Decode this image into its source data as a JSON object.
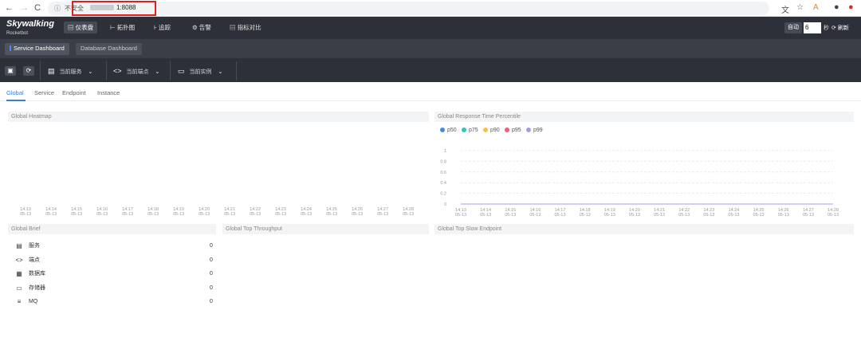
{
  "browser": {
    "security": "不安全",
    "url": "1:8088"
  },
  "app": {
    "logo": "Skywalking",
    "logo_sub": "Rocketbot",
    "nav": [
      {
        "icon": "dashboard-icon",
        "label": "仪表盘"
      },
      {
        "icon": "topology-icon",
        "label": "拓扑图"
      },
      {
        "icon": "trace-icon",
        "label": "追踪"
      },
      {
        "icon": "alarm-icon",
        "label": "告警"
      },
      {
        "icon": "metrics-compare-icon",
        "label": "指标对比"
      }
    ],
    "auto_label": "自动",
    "interval_value": "6",
    "interval_unit": "秒",
    "refresh_label": "刷新"
  },
  "dashboards": [
    "Service Dashboard",
    "Database Dashboard"
  ],
  "toolbar": {
    "selectors": [
      {
        "icon": "service-icon",
        "label": "当前服务"
      },
      {
        "icon": "endpoint-icon",
        "label": "当前端点"
      },
      {
        "icon": "instance-icon",
        "label": "当前实例"
      }
    ]
  },
  "tabs": [
    "Global",
    "Service",
    "Endpoint",
    "Instance"
  ],
  "panels": {
    "heatmap_title": "Global Heatmap",
    "percentile_title": "Global Response Time Percentile",
    "brief_title": "Global Brief",
    "throughput_title": "Global Top Throughput",
    "slow_title": "Global Top Slow Endpoint"
  },
  "heatmap_xticks": [
    [
      "14:13",
      "05-13"
    ],
    [
      "14:14",
      "05-13"
    ],
    [
      "14:15",
      "05-13"
    ],
    [
      "14:16",
      "05-13"
    ],
    [
      "14:17",
      "05-13"
    ],
    [
      "14:18",
      "05-13"
    ],
    [
      "14:19",
      "05-13"
    ],
    [
      "14:20",
      "05-13"
    ],
    [
      "14:21",
      "05-13"
    ],
    [
      "14:22",
      "05-13"
    ],
    [
      "14:23",
      "05-13"
    ],
    [
      "14:24",
      "05-13"
    ],
    [
      "14:25",
      "05-13"
    ],
    [
      "14:26",
      "05-13"
    ],
    [
      "14:27",
      "05-13"
    ],
    [
      "14:28",
      "05-13"
    ]
  ],
  "chart_data": {
    "type": "line",
    "title": "Global Response Time Percentile",
    "categories": [
      "14:13\n05-13",
      "14:14\n05-13",
      "14:15\n05-13",
      "14:16\n05-13",
      "14:17\n05-13",
      "14:18\n05-13",
      "14:19\n05-13",
      "14:20\n05-13",
      "14:21\n05-13",
      "14:22\n05-13",
      "14:23\n05-13",
      "14:24\n05-13",
      "14:25\n05-13",
      "14:26\n05-13",
      "14:27\n05-13",
      "14:28\n05-13"
    ],
    "yticks": [
      "1",
      "0.8",
      "0.6",
      "0.4",
      "0.2",
      "0"
    ],
    "ylim": [
      0,
      1
    ],
    "legend_position": "top-left",
    "grid": true,
    "series": [
      {
        "name": "p50",
        "color": "#3c8ee0",
        "values": [
          0,
          0,
          0,
          0,
          0,
          0,
          0,
          0,
          0,
          0,
          0,
          0,
          0,
          0,
          0,
          0
        ]
      },
      {
        "name": "p75",
        "color": "#2ec4b6",
        "values": [
          0,
          0,
          0,
          0,
          0,
          0,
          0,
          0,
          0,
          0,
          0,
          0,
          0,
          0,
          0,
          0
        ]
      },
      {
        "name": "p90",
        "color": "#f5c342",
        "values": [
          0,
          0,
          0,
          0,
          0,
          0,
          0,
          0,
          0,
          0,
          0,
          0,
          0,
          0,
          0,
          0
        ]
      },
      {
        "name": "p95",
        "color": "#ef5b78",
        "values": [
          0,
          0,
          0,
          0,
          0,
          0,
          0,
          0,
          0,
          0,
          0,
          0,
          0,
          0,
          0,
          0
        ]
      },
      {
        "name": "p99",
        "color": "#a19ee8",
        "values": [
          0,
          0,
          0,
          0,
          0,
          0,
          0,
          0,
          0,
          0,
          0,
          0,
          0,
          0,
          0,
          0
        ]
      }
    ]
  },
  "brief": [
    {
      "icon": "service-icon",
      "label": "服务",
      "value": "0"
    },
    {
      "icon": "endpoint-icon",
      "label": "端点",
      "value": "0"
    },
    {
      "icon": "database-icon",
      "label": "数据库",
      "value": "0"
    },
    {
      "icon": "storage-icon",
      "label": "存储器",
      "value": "0"
    },
    {
      "icon": "mq-icon",
      "label": "MQ",
      "value": "0"
    }
  ]
}
